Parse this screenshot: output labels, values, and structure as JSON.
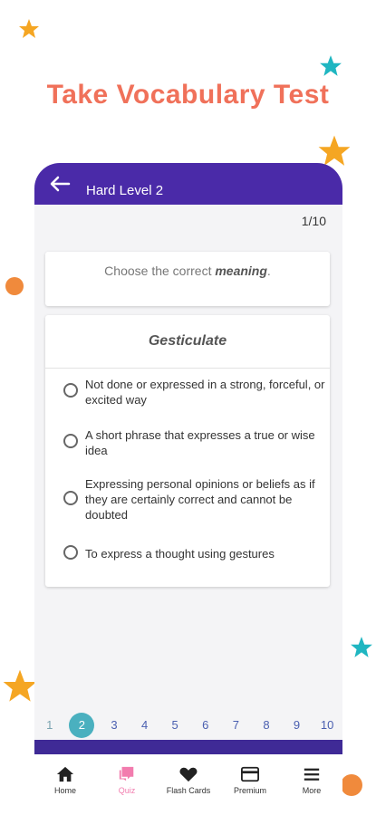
{
  "headline": "Take Vocabulary Test",
  "app_bar": {
    "title": "Hard Level 2"
  },
  "progress": {
    "counter": "1/10"
  },
  "instruction": {
    "prefix": "Choose the correct ",
    "emphasis": "meaning",
    "suffix": "."
  },
  "question": {
    "word": "Gesticulate",
    "options": [
      "Not done or expressed in a strong, forceful, or excited way",
      "A short phrase that expresses a true or wise idea",
      "Expressing personal opinions or beliefs as if they are certainly correct and cannot be doubted",
      "To express a thought using gestures"
    ]
  },
  "pager": {
    "pages": [
      "1",
      "2",
      "3",
      "4",
      "5",
      "6",
      "7",
      "8",
      "9",
      "10"
    ],
    "current": "2"
  },
  "nav": {
    "home": "Home",
    "quiz": "Quiz",
    "flash_cards": "Flash Cards",
    "premium": "Premium",
    "more": "More"
  },
  "colors": {
    "headline": "#f0715a",
    "app_bar": "#4a2aa8",
    "active_page": "#4ab0bf",
    "active_nav": "#f27cae",
    "star_orange": "#f5a623",
    "star_teal": "#1fb6c1",
    "dot_orange": "#f08a3c"
  }
}
